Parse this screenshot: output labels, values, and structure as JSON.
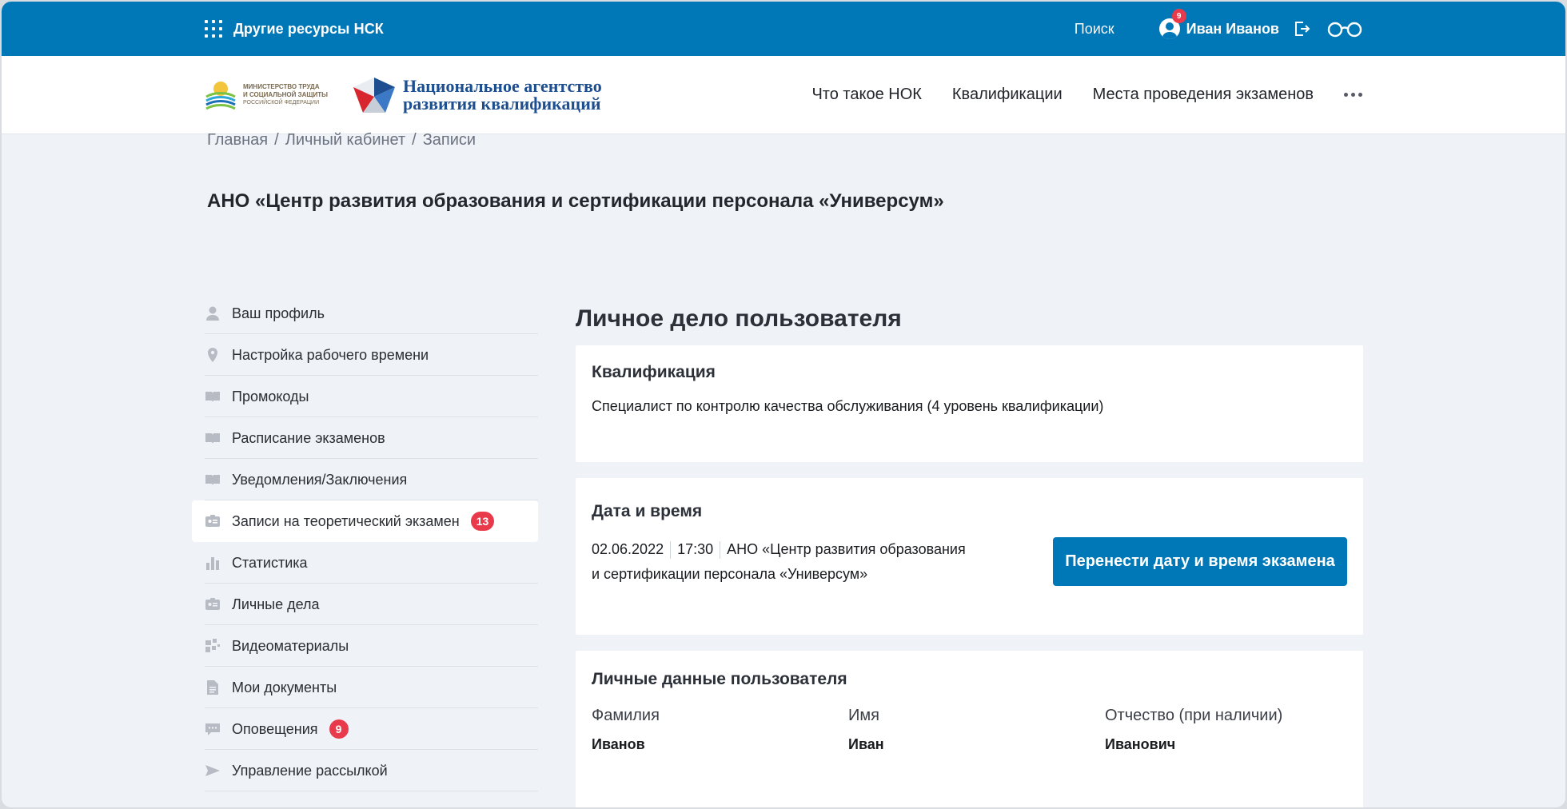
{
  "topbar": {
    "apps_label": "Другие ресурсы НСК",
    "search_label": "Поиск",
    "user_name": "Иван Иванов",
    "user_badge": "9"
  },
  "header": {
    "logo1_line1": "МИНИСТЕРСТВО ТРУДА",
    "logo1_line2": "И СОЦИАЛЬНОЙ ЗАЩИТЫ",
    "logo1_line3": "РОССИЙСКОЙ ФЕДЕРАЦИИ",
    "logo2_line1": "Национальное агентство",
    "logo2_line2": "развития квалификаций",
    "nav": [
      "Что такое НОК",
      "Квалификации",
      "Места проведения экзаменов"
    ]
  },
  "breadcrumb": [
    "Главная",
    "/",
    "Личный кабинет",
    "/",
    "Записи"
  ],
  "org_title": "АНО «Центр развития образования и сертификации персонала «Универсум»",
  "sidebar": {
    "items": [
      {
        "label": "Ваш профиль",
        "icon": "user-icon"
      },
      {
        "label": "Настройка рабочего времени",
        "icon": "location-pin-icon"
      },
      {
        "label": "Промокоды",
        "icon": "book-icon"
      },
      {
        "label": "Расписание экзаменов",
        "icon": "book-icon"
      },
      {
        "label": "Уведомления/Заключения",
        "icon": "book-icon"
      },
      {
        "label": "Записи на теоретический экзамен",
        "icon": "id-card-icon",
        "badge": "13"
      },
      {
        "label": "Статистика",
        "icon": "bar-chart-icon"
      },
      {
        "label": "Личные дела",
        "icon": "id-card-icon"
      },
      {
        "label": "Видеоматериалы",
        "icon": "video-icon"
      },
      {
        "label": "Мои документы",
        "icon": "document-icon"
      },
      {
        "label": "Оповещения",
        "icon": "chat-icon",
        "badge": "9"
      },
      {
        "label": "Управление рассылкой",
        "icon": "send-icon"
      }
    ]
  },
  "main": {
    "title": "Личное дело пользователя",
    "qualification": {
      "heading": "Квалификация",
      "value": "Специалист по контролю качества обслуживания (4 уровень квалификации)"
    },
    "datetime": {
      "heading": "Дата и время",
      "date": "02.06.2022",
      "time": "17:30",
      "place_line1": "АНО «Центр развития образования",
      "place_line2": "и сертификации персонала «Универсум»",
      "button": "Перенести дату и время экзамена"
    },
    "personal": {
      "heading": "Личные данные пользователя",
      "fields": [
        {
          "label": "Фамилия",
          "value": "Иванов"
        },
        {
          "label": "Имя",
          "value": "Иван"
        },
        {
          "label": "Отчество (при наличии)",
          "value": "Иванович"
        }
      ]
    }
  },
  "colors": {
    "brand": "#0077b6",
    "badge": "#e83a4b",
    "background": "#eff2f6"
  }
}
